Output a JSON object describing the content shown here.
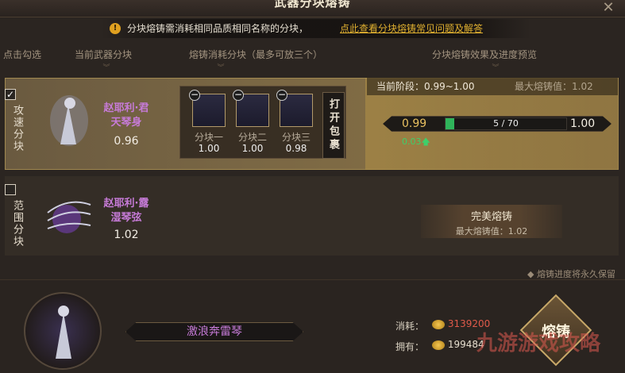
{
  "window": {
    "title": "武器分块熔铸",
    "close_icon": "close-icon"
  },
  "notice": {
    "text": "分块熔铸需消耗相同品质相同名称的分块，",
    "link": "点此查看分块熔铸常见问题及解答"
  },
  "headers": {
    "select": "点击勾选",
    "current_block": "当前武器分块",
    "consume": "熔铸消耗分块（最多可放三个）",
    "preview": "分块熔铸效果及进度预览"
  },
  "rows": [
    {
      "checked": true,
      "category": "攻速分块",
      "name_line1": "赵耶利·君",
      "name_line2": "天琴身",
      "value": "0.96",
      "materials": [
        {
          "label": "分块一",
          "value": "1.00"
        },
        {
          "label": "分块二",
          "value": "1.00"
        },
        {
          "label": "分块三",
          "value": "0.98"
        }
      ],
      "open_bag": "打开包裹",
      "stage_label": "当前阶段：0.99~1.00",
      "max_label": "最大熔铸值：1.02",
      "progress": {
        "left": "0.99",
        "right": "1.00",
        "text": "5 / 70",
        "current": 5,
        "total": 70,
        "delta": "0.03"
      }
    },
    {
      "checked": false,
      "category": "范围分块",
      "name_line1": "赵耶利·露",
      "name_line2": "湿琴弦",
      "value": "1.02",
      "perfect_title": "完美熔铸",
      "perfect_max": "最大熔铸值：1.02"
    }
  ],
  "footer_note": "◆ 熔铸进度将永久保留",
  "bottom": {
    "weapon_name": "激浪奔雷琴",
    "cost_label": "消耗：",
    "cost_value": "3139200",
    "own_label": "拥有：",
    "own_value": "199484",
    "forge_button": "熔铸"
  },
  "watermark": "九游游戏攻略",
  "colors": {
    "accent_gold": "#e0b030",
    "progress_green": "#2fb45a",
    "purple_name": "#c77bd8",
    "cost_red": "#e05a4a"
  }
}
